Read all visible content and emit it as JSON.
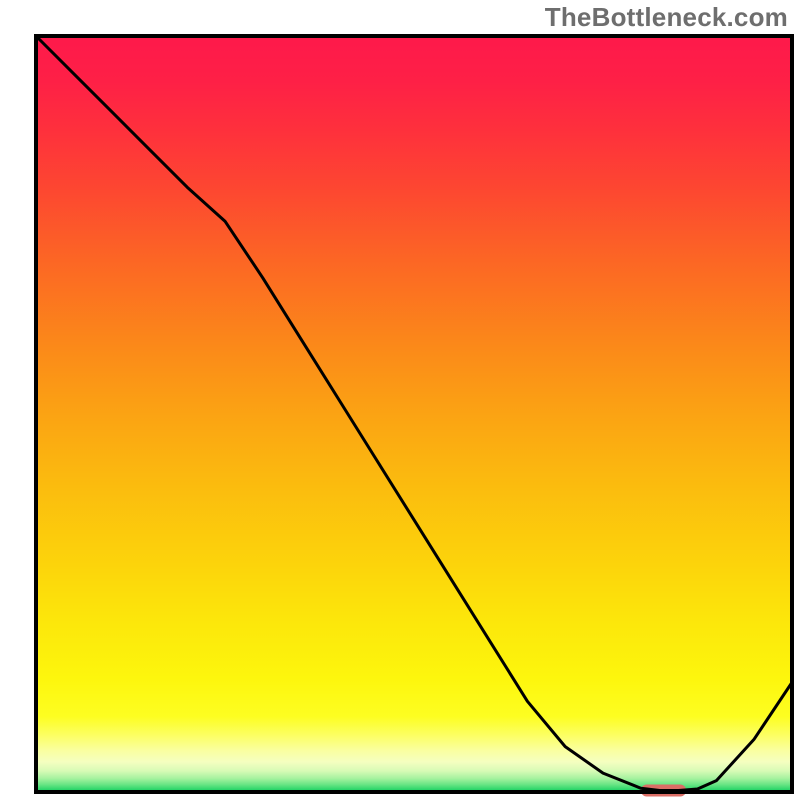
{
  "watermark": "TheBottleneck.com",
  "chart_data": {
    "type": "line",
    "title": "",
    "xlabel": "",
    "ylabel": "",
    "xlim": [
      0,
      100
    ],
    "ylim": [
      0,
      100
    ],
    "grid": false,
    "series": [
      {
        "name": "curve",
        "x": [
          0,
          5,
          10,
          15,
          20,
          25,
          30,
          35,
          40,
          45,
          50,
          55,
          60,
          65,
          70,
          75,
          80,
          82.5,
          85,
          87.5,
          90,
          95,
          100
        ],
        "y": [
          100,
          95,
          90,
          85,
          80,
          75.5,
          68,
          60,
          52,
          44,
          36,
          28,
          20,
          12,
          6,
          2.5,
          0.5,
          0.2,
          0.2,
          0.4,
          1.5,
          7,
          14.5
        ],
        "stroke": "#000000",
        "stroke_width": 3
      }
    ],
    "highlight_segment": {
      "x_start": 80,
      "x_end": 86,
      "color": "#db6e66",
      "thickness": 12
    },
    "frame": {
      "x": 4.5,
      "y": 4.5,
      "width": 94.5,
      "height": 94.5,
      "stroke": "#000000",
      "stroke_width": 4
    },
    "gradient_stops": [
      {
        "offset": 0.0,
        "color": "#fe194b"
      },
      {
        "offset": 0.06,
        "color": "#fe2046"
      },
      {
        "offset": 0.12,
        "color": "#fe2f3d"
      },
      {
        "offset": 0.2,
        "color": "#fd4631"
      },
      {
        "offset": 0.3,
        "color": "#fc6724"
      },
      {
        "offset": 0.4,
        "color": "#fb861a"
      },
      {
        "offset": 0.5,
        "color": "#fba313"
      },
      {
        "offset": 0.6,
        "color": "#fbbd0e"
      },
      {
        "offset": 0.7,
        "color": "#fcd40b"
      },
      {
        "offset": 0.78,
        "color": "#fce80b"
      },
      {
        "offset": 0.85,
        "color": "#fdf60d"
      },
      {
        "offset": 0.9,
        "color": "#fdfe21"
      },
      {
        "offset": 0.925,
        "color": "#fcff63"
      },
      {
        "offset": 0.945,
        "color": "#faffa0"
      },
      {
        "offset": 0.96,
        "color": "#f5ffc0"
      },
      {
        "offset": 0.972,
        "color": "#d8fbb6"
      },
      {
        "offset": 0.982,
        "color": "#a6f29f"
      },
      {
        "offset": 0.99,
        "color": "#6ae585"
      },
      {
        "offset": 0.996,
        "color": "#33d76d"
      },
      {
        "offset": 1.0,
        "color": "#0dce5c"
      }
    ]
  }
}
